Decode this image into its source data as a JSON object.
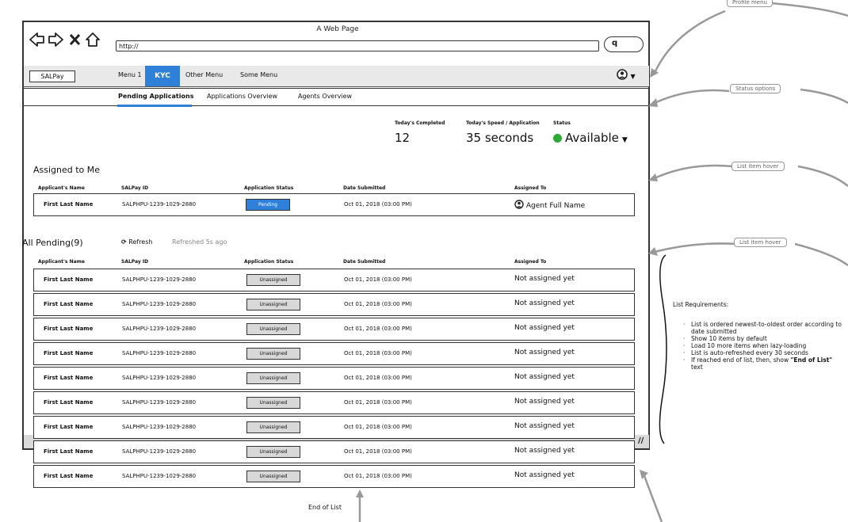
{
  "browser": {
    "window_title": "A Web Page",
    "url": "http://",
    "search_glyph": "q"
  },
  "nav": {
    "logo": "SALPay",
    "items": [
      "Menu 1",
      "KYC",
      "Other Menu",
      "Some Menu"
    ],
    "active_item": "KYC",
    "profile_icon": "user-circle-icon"
  },
  "subnav": {
    "tabs": [
      "Pending Applications",
      "Applications Overview",
      "Agents Overview"
    ],
    "active_tab": "Pending Applications"
  },
  "stats": {
    "completed_label": "Today's Completed",
    "completed_value": "12",
    "speed_label": "Today's Speed / Application",
    "speed_value": "35 seconds",
    "status_label": "Status",
    "status_value": "Available",
    "status_color": "#2ea836"
  },
  "columns": [
    "Applicant's Name",
    "SALPay ID",
    "Application Status",
    "Date Submitted",
    "Assigned To"
  ],
  "assigned": {
    "title": "Assigned to Me",
    "rows": [
      {
        "name": "First Last Name",
        "id": "SALPHPU-1239-1029-2880",
        "status": "Pending",
        "date": "Oct 01, 2018 (03:00 PM)",
        "assignee": "Agent Full Name"
      }
    ]
  },
  "pending": {
    "title": "All Pending(9)",
    "refresh_label": "Refresh",
    "refreshed_text": "Refreshed 5s ago",
    "rows": [
      {
        "name": "First Last Name",
        "id": "SALPHPU-1239-1029-2880",
        "status": "Unassigned",
        "date": "Oct 01, 2018 (03:00 PM)",
        "assignee": "Not assigned yet"
      },
      {
        "name": "First Last Name",
        "id": "SALPHPU-1239-1029-2880",
        "status": "Unassigned",
        "date": "Oct 01, 2018 (03:00 PM)",
        "assignee": "Not assigned yet"
      },
      {
        "name": "First Last Name",
        "id": "SALPHPU-1239-1029-2880",
        "status": "Unassigned",
        "date": "Oct 01, 2018 (03:00 PM)",
        "assignee": "Not assigned yet"
      },
      {
        "name": "First Last Name",
        "id": "SALPHPU-1239-1029-2880",
        "status": "Unassigned",
        "date": "Oct 01, 2018 (03:00 PM)",
        "assignee": "Not assigned yet"
      },
      {
        "name": "First Last Name",
        "id": "SALPHPU-1239-1029-2880",
        "status": "Unassigned",
        "date": "Oct 01, 2018 (03:00 PM)",
        "assignee": "Not assigned yet"
      },
      {
        "name": "First Last Name",
        "id": "SALPHPU-1239-1029-2880",
        "status": "Unassigned",
        "date": "Oct 01, 2018 (03:00 PM)",
        "assignee": "Not assigned yet"
      },
      {
        "name": "First Last Name",
        "id": "SALPHPU-1239-1029-2880",
        "status": "Unassigned",
        "date": "Oct 01, 2018 (03:00 PM)",
        "assignee": "Not assigned yet"
      },
      {
        "name": "First Last Name",
        "id": "SALPHPU-1239-1029-2880",
        "status": "Unassigned",
        "date": "Oct 01, 2018 (03:00 PM)",
        "assignee": "Not assigned yet"
      },
      {
        "name": "First Last Name",
        "id": "SALPHPU-1239-1029-2880",
        "status": "Unassigned",
        "date": "Oct 01, 2018 (03:00 PM)",
        "assignee": "Not assigned yet"
      }
    ],
    "end_of_list": "End of List"
  },
  "annotations": {
    "profile_menu": "Profile menu",
    "status_options": "Status options",
    "list_item_hover_1": "List item hover",
    "list_item_hover_2": "List item hover",
    "requirements_title": "List Requirements:",
    "requirements": [
      "List is ordered newest-to-oldest order according to date submitted",
      "Show 10 items by default",
      "Load 10 more items when lazy-loading",
      "List is auto-refreshed every 30 seconds"
    ],
    "requirement_last_before": "If reached end of list, then, show ",
    "requirement_last_bold": "\"End of List\"",
    "requirement_last_after": " text"
  },
  "colors": {
    "accent": "#2f80d8",
    "available": "#2ea836",
    "unassigned_badge": "#d8d8d8"
  }
}
